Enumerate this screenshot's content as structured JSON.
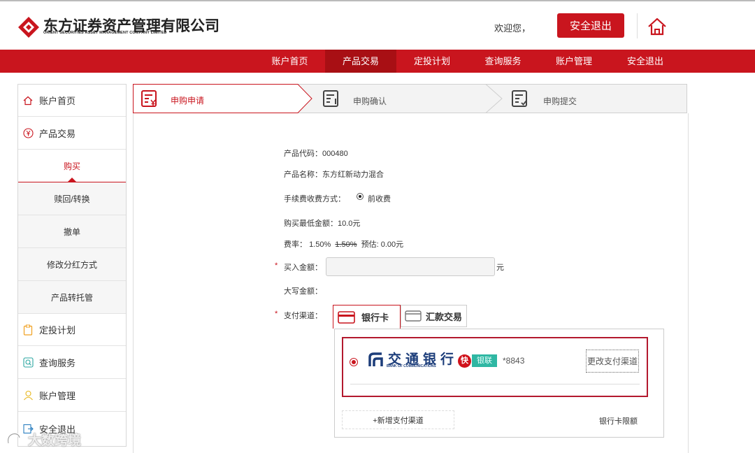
{
  "header": {
    "logo_cn": "东方证券资产管理有限公司",
    "logo_en": "ORIENT SECURITIES ASSET MANAGEMENT COMPANY LIMITED",
    "welcome": "欢迎您，",
    "logout_button": "安全退出",
    "home_icon": "home-icon"
  },
  "nav": {
    "items": [
      "账户首页",
      "产品交易",
      "定投计划",
      "查询服务",
      "账户管理",
      "安全退出"
    ],
    "active": "产品交易"
  },
  "sidebar": {
    "items": [
      {
        "label": "账户首页",
        "icon": "home-icon"
      },
      {
        "label": "产品交易",
        "icon": "yen-icon"
      },
      {
        "label": "定投计划",
        "icon": "clipboard-icon"
      },
      {
        "label": "查询服务",
        "icon": "search-icon"
      },
      {
        "label": "账户管理",
        "icon": "user-icon"
      },
      {
        "label": "安全退出",
        "icon": "exit-icon"
      }
    ],
    "subitems": [
      "购买",
      "赎回/转换",
      "撤单",
      "修改分红方式",
      "产品转托管"
    ],
    "active_sub": "购买"
  },
  "steps": [
    {
      "label": "申购申请",
      "icon": "form-yen-icon"
    },
    {
      "label": "申购确认",
      "icon": "form-alert-icon"
    },
    {
      "label": "申购提交",
      "icon": "form-check-icon"
    }
  ],
  "form": {
    "product_code_label": "产品代码：",
    "product_code": "000480",
    "product_name_label": "产品名称：",
    "product_name": "东方红新动力混合",
    "fee_mode_label": "手续费收费方式：",
    "fee_mode_option": "前收费",
    "min_amount_label": "购买最低金额：",
    "min_amount": "10.0元",
    "rate_label": "费率：",
    "rate": "1.50%",
    "rate_original": "1.50%",
    "estimate_label": "预估:",
    "estimate": "0.00元",
    "required_mark": "*",
    "amount_label": "买入金额：",
    "amount_value": "",
    "amount_unit": "元",
    "amount_upper_label": "大写金额：",
    "pay_channel_label": "支付渠道："
  },
  "payment": {
    "tabs": [
      "银行卡",
      "汇款交易"
    ],
    "active_tab": "银行卡",
    "bank_name": "交通银行",
    "bank_en": "BANK OF COMMUNICATIONS",
    "fast_badge": "快",
    "unionpay_badge": "银联",
    "card_tail": "*8843",
    "change_button": "更改支付渠道",
    "add_button": "+新增支付渠道",
    "limit_link": "银行卡限额"
  },
  "watermark": "大数跨境",
  "colors": {
    "brand_red": "#c9151e",
    "nav_active": "#a80f14",
    "bank_blue": "#1c3d7a"
  }
}
